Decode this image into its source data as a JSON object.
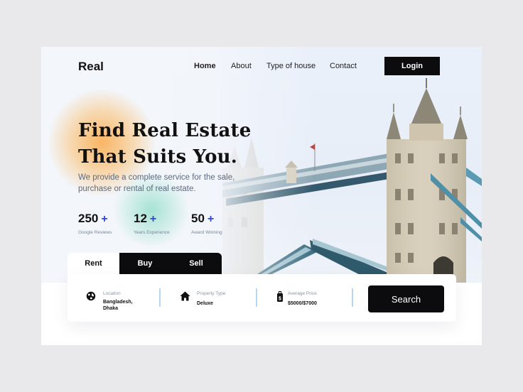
{
  "brand": "Real",
  "nav": {
    "items": [
      "Home",
      "About",
      "Type of house",
      "Contact"
    ],
    "login_label": "Login"
  },
  "hero": {
    "headline_line1": "Find Real Estate",
    "headline_line2": "That Suits You.",
    "subtitle_line1": "We provide a complete service for the sale,",
    "subtitle_line2": "purchase or rental of real estate."
  },
  "stats": [
    {
      "value": "250",
      "plus": "+",
      "label": "Google Reviews"
    },
    {
      "value": "12",
      "plus": "+",
      "label": "Years Experience"
    },
    {
      "value": "50",
      "plus": "+",
      "label": "Award Winning"
    }
  ],
  "tabs": [
    "Rent",
    "Buy",
    "Sell"
  ],
  "search": {
    "location": {
      "label": "Location",
      "value_line1": "Bangladesh,",
      "value_line2": "Dhaka",
      "icon": "globe-icon"
    },
    "property_type": {
      "label": "Property Type",
      "value": "Deluxe",
      "icon": "house-icon"
    },
    "price": {
      "label": "Average Price",
      "value": "$5000/$7000",
      "icon": "price-tag-icon"
    },
    "button_label": "Search"
  },
  "colors": {
    "accent": "#3144d6",
    "dark": "#0c0c0e",
    "divider": "#b9d7f2"
  }
}
